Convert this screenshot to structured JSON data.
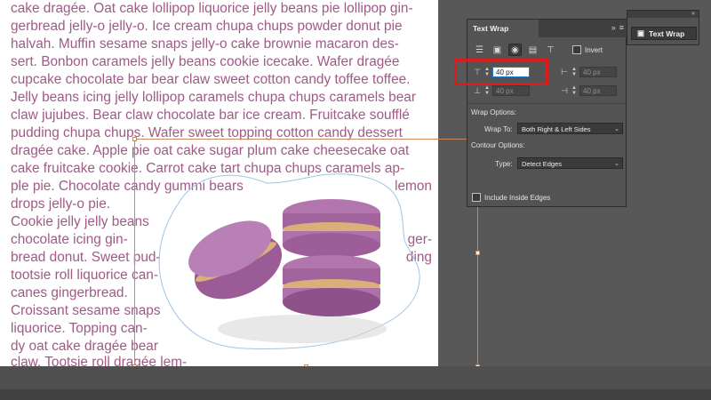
{
  "document": {
    "lines_full": [
      "cake dragée. Oat cake lollipop liquorice jelly beans pie lollipop gin-",
      "gerbread jelly-o jelly-o. Ice cream chupa chups powder donut pie",
      "halvah. Muffin sesame snaps jelly-o cake brownie macaron des-",
      "sert. Bonbon caramels jelly beans cookie icecake. Wafer dragée",
      "cupcake chocolate bar bear claw sweet cotton candy toffee toffee.",
      "Jelly beans icing jelly lollipop caramels chupa chups caramels bear",
      "claw jujubes. Bear claw chocolate bar ice cream. Fruitcake soufflé",
      "pudding chupa chups. Wafer sweet topping cotton candy dessert",
      "dragée cake. Apple pie oat cake sugar plum cake cheesecake oat",
      "cake fruitcake cookie. Carrot cake tart chupa chups caramels ap-"
    ],
    "lines_left": [
      "ple pie. Chocolate candy gummi bears",
      "drops jelly-o pie.",
      "Cookie jelly jelly beans",
      "chocolate icing gin-",
      "bread donut. Sweet pud-",
      "tootsie roll liquorice can-",
      "canes gingerbread.",
      "Croissant sesame snaps",
      "liquorice. Topping can-",
      "dy oat cake dragée bear",
      "claw. Tootsie roll dragée lem-"
    ],
    "lines_right": {
      "line1": "lemon",
      "line2": "ger-",
      "line3": "ding"
    }
  },
  "panel": {
    "title": "Text Wrap",
    "invert_label": "Invert",
    "offsets": {
      "top": "40 px",
      "bottom": "40 px",
      "left": "40 px",
      "right": "40 px"
    },
    "wrap_options_label": "Wrap Options:",
    "wrap_to_label": "Wrap To:",
    "wrap_to_value": "Both Right & Left Sides",
    "contour_options_label": "Contour Options:",
    "type_label": "Type:",
    "type_value": "Detect Edges",
    "include_inside_edges_label": "Include Inside Edges"
  },
  "panel2": {
    "title": "Text Wrap"
  },
  "colors": {
    "text": "#a05a86",
    "frame": "#c88a5c",
    "highlight": "#e01a1a",
    "macaron": "#b275ae"
  }
}
